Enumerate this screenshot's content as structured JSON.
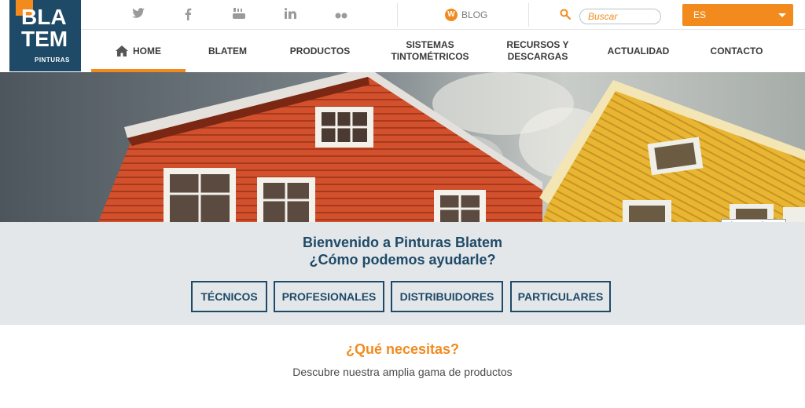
{
  "logo": {
    "line1": "BLA",
    "line2": "TEM",
    "sub": "PINTURAS"
  },
  "topbar": {
    "social_icons": [
      "twitter-icon",
      "facebook-icon",
      "youtube-icon",
      "linkedin-icon",
      "flickr-icon"
    ],
    "blog_label": "BLOG",
    "search_placeholder": "Buscar",
    "language": "ES"
  },
  "nav": {
    "items": [
      {
        "label": "HOME"
      },
      {
        "label": "BLATEM"
      },
      {
        "label": "PRODUCTOS"
      },
      {
        "label_line1": "SISTEMAS",
        "label_line2": "TINTOMÉTRICOS"
      },
      {
        "label_line1": "RECURSOS Y",
        "label_line2": "DESCARGAS"
      },
      {
        "label": "ACTUALIDAD"
      },
      {
        "label": "CONTACTO"
      }
    ]
  },
  "hero": {
    "tooltip": "Pinturas Blatem"
  },
  "welcome": {
    "title_line1": "Bienvenido a Pinturas Blatem",
    "title_line2": "¿Cómo podemos ayudarle?",
    "buttons": [
      "TÉCNICOS",
      "PROFESIONALES",
      "DISTRIBUIDORES",
      "PARTICULARES"
    ]
  },
  "section": {
    "heading": "¿Qué necesitas?",
    "description": "Descubre nuestra amplia gama de productos"
  },
  "colors": {
    "brand_blue": "#1f4a67",
    "brand_orange": "#f28a1e"
  }
}
